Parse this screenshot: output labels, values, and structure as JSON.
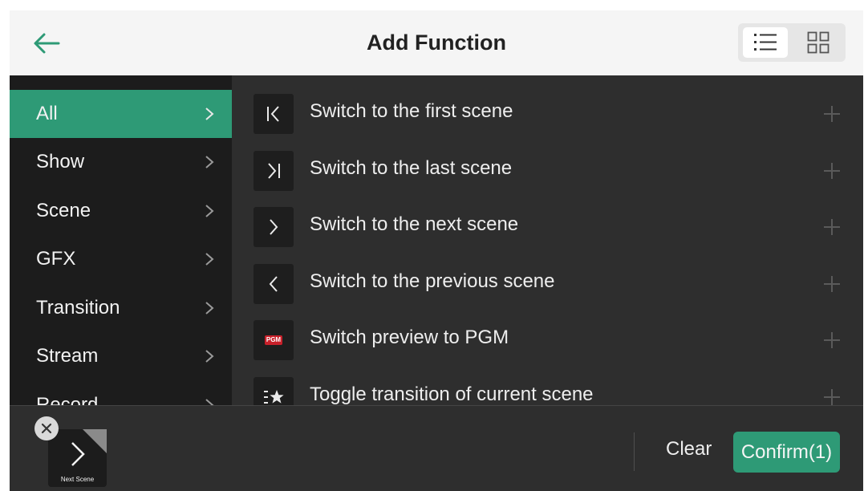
{
  "header": {
    "title": "Add Function",
    "back_icon": "arrow-left-icon",
    "view_modes": [
      {
        "name": "list",
        "icon": "list-icon",
        "active": true
      },
      {
        "name": "grid",
        "icon": "grid-icon",
        "active": false
      }
    ]
  },
  "sidebar": {
    "items": [
      {
        "label": "All",
        "active": true
      },
      {
        "label": "Show",
        "active": false
      },
      {
        "label": "Scene",
        "active": false
      },
      {
        "label": "GFX",
        "active": false
      },
      {
        "label": "Transition",
        "active": false
      },
      {
        "label": "Stream",
        "active": false
      },
      {
        "label": "Record",
        "active": false
      }
    ]
  },
  "functions": [
    {
      "label": "Switch to the first scene",
      "icon": "first-scene-icon"
    },
    {
      "label": "Switch to the last scene",
      "icon": "last-scene-icon"
    },
    {
      "label": "Switch to the next scene",
      "icon": "next-scene-icon"
    },
    {
      "label": "Switch to the previous scene",
      "icon": "previous-scene-icon"
    },
    {
      "label": "Switch preview to PGM",
      "icon": "pgm-icon",
      "badge": "PGM"
    },
    {
      "label": "Toggle transition of current scene",
      "icon": "toggle-transition-icon"
    }
  ],
  "selected": {
    "items": [
      {
        "label": "Next Scene",
        "icon": "next-scene-icon"
      }
    ]
  },
  "footer": {
    "clear_label": "Clear",
    "confirm_label": "Confirm(1)"
  },
  "colors": {
    "accent": "#2e9a76",
    "panel": "#2e2e2e",
    "sidebar": "#1c1c1c"
  }
}
